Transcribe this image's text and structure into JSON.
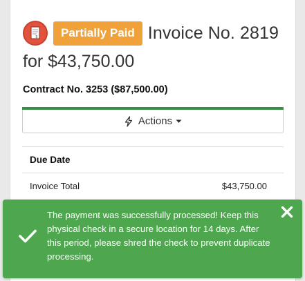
{
  "invoice": {
    "status": "Partially Paid",
    "title": "Invoice No. 2819",
    "amount": "for $43,750.00",
    "contract": "Contract No. 3253 ($87,500.00)",
    "progress_fraction": 1.0,
    "actions_label": "Actions"
  },
  "details": {
    "due_date_label": "Due Date",
    "total_label": "Invoice Total",
    "total_value": "$43,750.00"
  },
  "toast": {
    "message": "The payment was successfully processed! Keep this physical check in a secure location for 14 days. After this period, please shred the check to prevent duplicate processing.",
    "icon": "check-icon",
    "close_icon": "close-icon"
  },
  "colors": {
    "badge": "#f0a13a",
    "toast": "#4ea64f",
    "progress": "#3a8f47",
    "doc_icon": "#e2533e"
  }
}
